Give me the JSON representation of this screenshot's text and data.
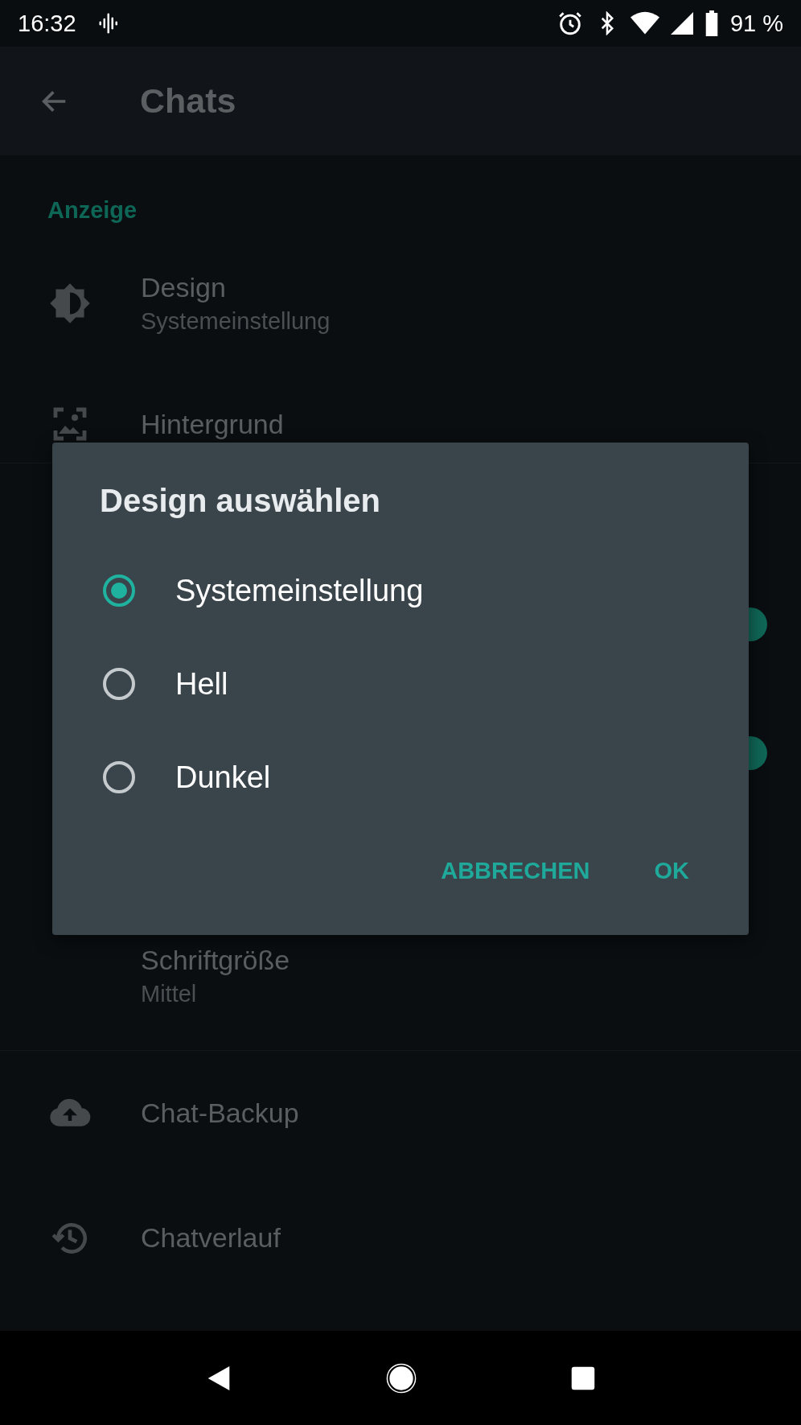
{
  "status_bar": {
    "time": "16:32",
    "battery": "91 %"
  },
  "app_bar": {
    "title": "Chats"
  },
  "sections": [
    {
      "header": "Anzeige",
      "items": [
        {
          "kind": "icon",
          "title": "Design",
          "subtitle": "Systemeinstellung"
        },
        {
          "kind": "icon",
          "title": "Hintergrund"
        }
      ]
    },
    {
      "items": [
        {
          "kind": "toggle",
          "on": true
        },
        {
          "kind": "toggle",
          "on": true
        },
        {
          "kind": "text",
          "title": "Schriftgröße",
          "subtitle": "Mittel"
        }
      ]
    },
    {
      "items": [
        {
          "kind": "icon",
          "title": "Chat-Backup"
        },
        {
          "kind": "icon",
          "title": "Chatverlauf"
        }
      ]
    }
  ],
  "dialog": {
    "title": "Design auswählen",
    "options": [
      {
        "label": "Systemeinstellung",
        "selected": true
      },
      {
        "label": "Hell",
        "selected": false
      },
      {
        "label": "Dunkel",
        "selected": false
      }
    ],
    "buttons": [
      "ABBRECHEN",
      "OK"
    ]
  }
}
